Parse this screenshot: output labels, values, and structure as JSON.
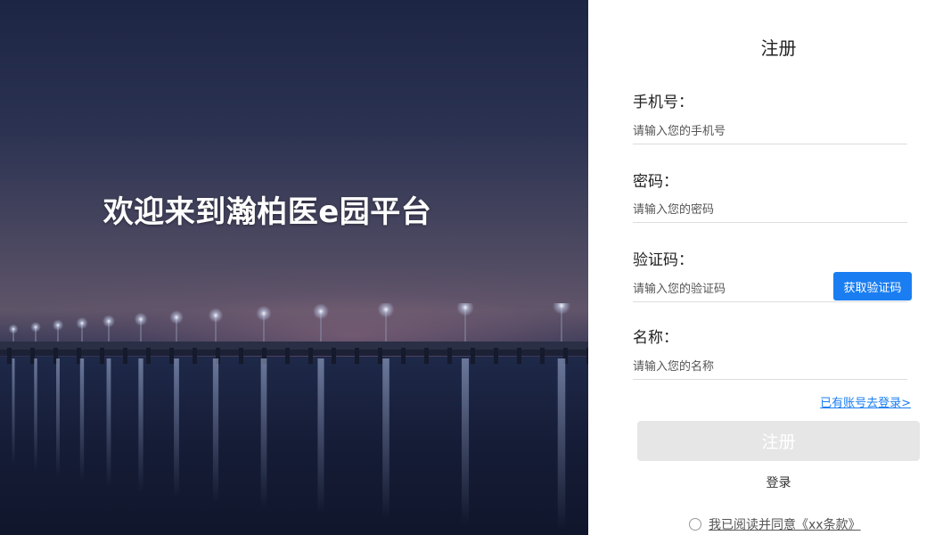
{
  "hero": {
    "welcome_text": "欢迎来到瀚柏医e园平台"
  },
  "form": {
    "title": "注册",
    "phone": {
      "label": "手机号：",
      "placeholder": "请输入您的手机号"
    },
    "password": {
      "label": "密码：",
      "placeholder": "请输入您的密码"
    },
    "code": {
      "label": "验证码：",
      "placeholder": "请输入您的验证码",
      "button_label": "获取验证码"
    },
    "name": {
      "label": "名称：",
      "placeholder": "请输入您的名称"
    },
    "login_link": "已有账号去登录>",
    "register_button": "注册",
    "alt_login": "登录",
    "agreement": "我已阅读并同意《xx条款》"
  },
  "colors": {
    "accent": "#1a7ef2",
    "disabled_button": "#e6e6e6"
  }
}
